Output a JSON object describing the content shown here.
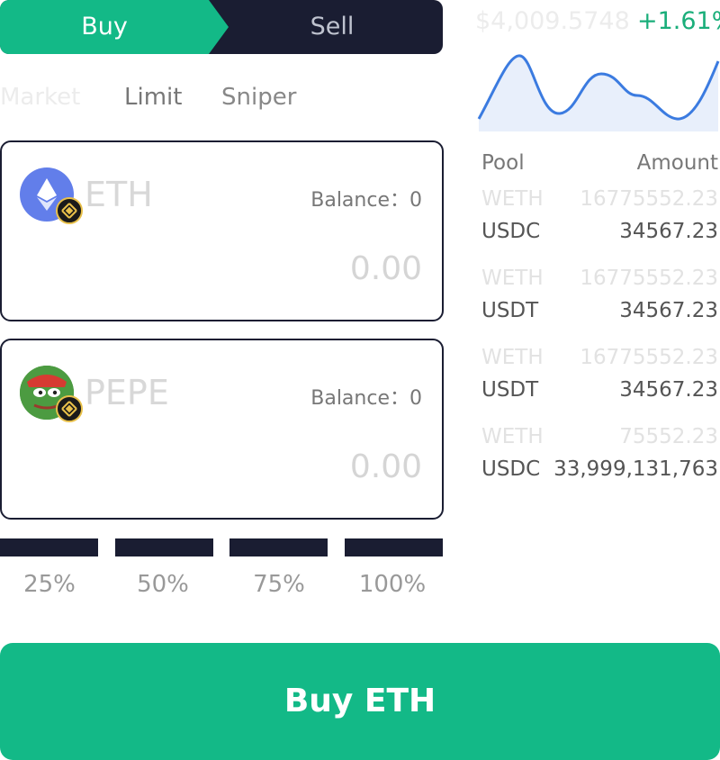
{
  "side_toggle": {
    "buy_label": "Buy",
    "sell_label": "Sell"
  },
  "order_tabs": [
    "Market",
    "Limit",
    "Sniper"
  ],
  "pay_token": {
    "symbol": "ETH",
    "balance": "Balance：0",
    "amount": "0.00",
    "icon": "ethereum-icon",
    "chain_icon": "bnb-chain-icon"
  },
  "receive_token": {
    "symbol": "PEPE",
    "balance": "Balance：0",
    "amount": "0.00",
    "icon": "pepe-icon",
    "chain_icon": "bnb-chain-icon"
  },
  "percent_options": [
    "25%",
    "50%",
    "75%",
    "100%"
  ],
  "market": {
    "price": "$4,009.5748",
    "change": "+1.61%",
    "pool_header": "Pool",
    "amount_header": "Amount",
    "pools": [
      {
        "base": "WETH",
        "base_amount": "16775552.23",
        "quote": "USDC",
        "quote_amount": "34567.23"
      },
      {
        "base": "WETH",
        "base_amount": "16775552.23",
        "quote": "USDT",
        "quote_amount": "34567.23"
      },
      {
        "base": "WETH",
        "base_amount": "16775552.23",
        "quote": "USDT",
        "quote_amount": "34567.23"
      },
      {
        "base": "WETH",
        "base_amount": "75552.23",
        "quote": "USDC",
        "quote_amount": "33,999,131,763"
      }
    ]
  },
  "action": {
    "label": "Buy ETH"
  },
  "colors": {
    "green": "#13b987",
    "navy": "#1a1d32",
    "change_green": "#1aae7a",
    "chart_line": "#3b7be0",
    "chart_fill": "#e8effb"
  }
}
